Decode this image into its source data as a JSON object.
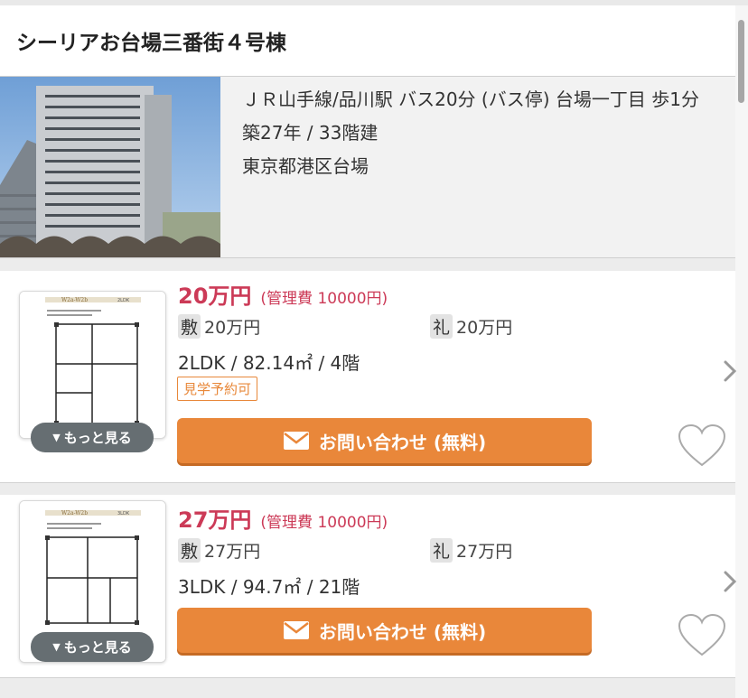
{
  "header": {
    "title": "シーリアお台場三番街４号棟"
  },
  "building": {
    "access": "ＪＲ山手線/品川駅 バス20分 (バス停) 台場一丁目 歩1分",
    "age_floors": "築27年 / 33階建",
    "address": "東京都港区台場"
  },
  "listings": [
    {
      "rent": "20万円",
      "management_fee": "(管理費 10000円)",
      "deposit_label": "敷",
      "deposit": "20万円",
      "key_money_label": "礼",
      "key_money": "20万円",
      "spec": "2LDK / 82.14㎡ / 4階",
      "tag": "見学予約可",
      "floorplan_title": "W2a-W2b",
      "floorplan_type": "2LDK",
      "more_label": "もっと見る",
      "cta_label": "お問い合わせ (無料)"
    },
    {
      "rent": "27万円",
      "management_fee": "(管理費 10000円)",
      "deposit_label": "敷",
      "deposit": "27万円",
      "key_money_label": "礼",
      "key_money": "27万円",
      "spec": "3LDK / 94.7㎡ / 21階",
      "floorplan_title": "W2a-W2b",
      "floorplan_type": "3LDK",
      "more_label": "もっと見る",
      "cta_label": "お問い合わせ (無料)"
    }
  ],
  "colors": {
    "price": "#cc3a57",
    "accent": "#e9873a",
    "tag": "#e8883a"
  },
  "icons": [
    "building-photo",
    "floorplan-image",
    "mail-icon",
    "heart-icon",
    "chevron-right-icon",
    "caret-down-icon"
  ]
}
